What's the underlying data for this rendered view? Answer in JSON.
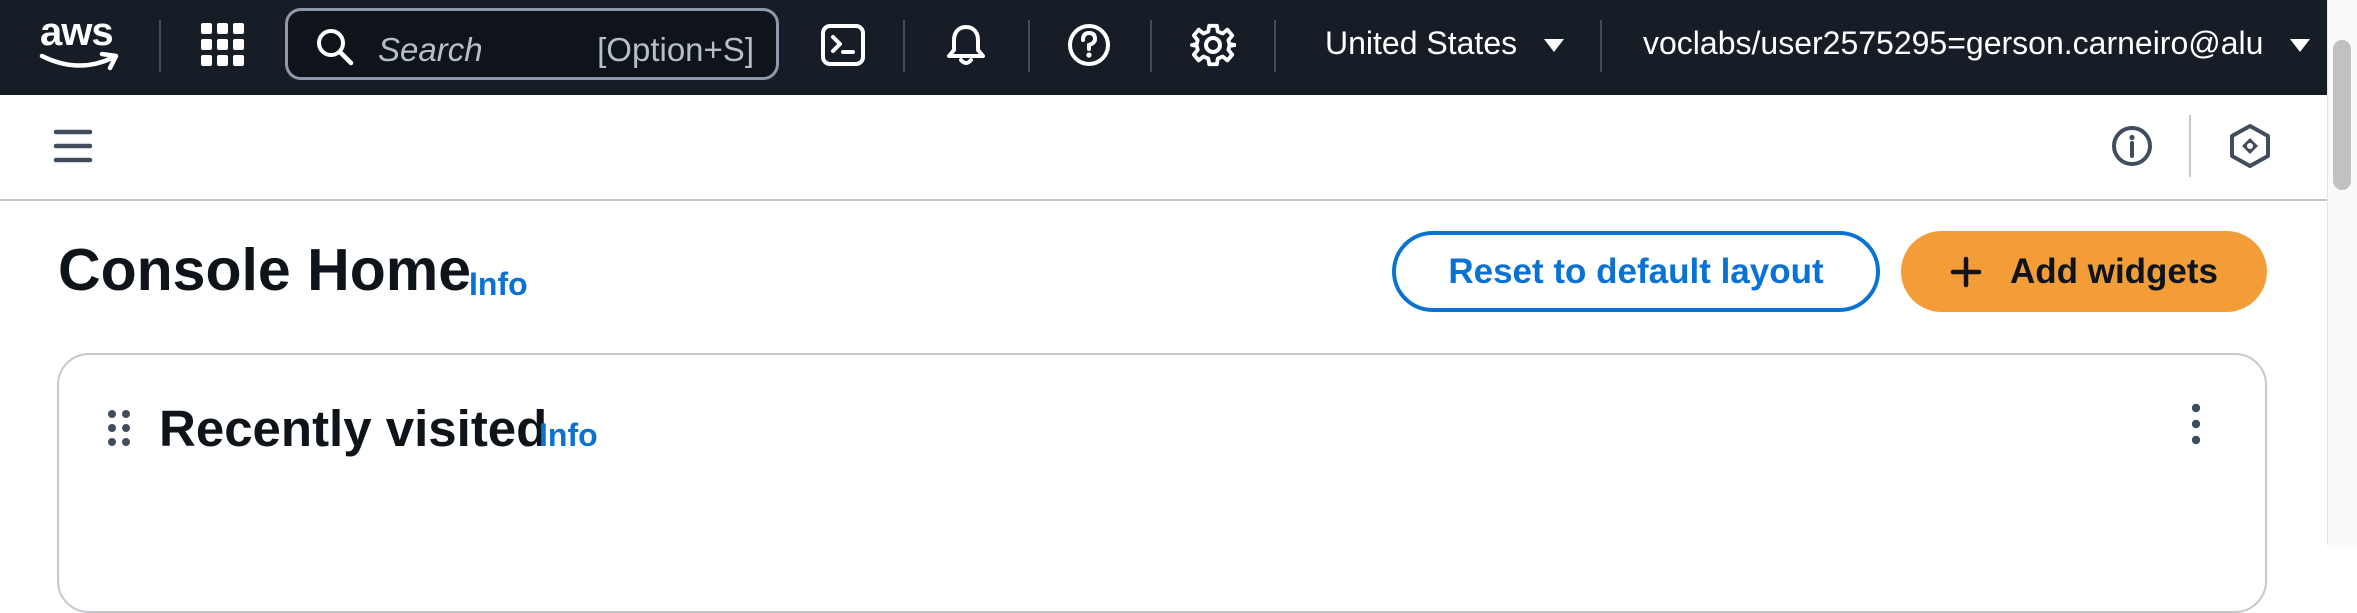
{
  "topnav": {
    "logo_text": "aws",
    "search": {
      "placeholder": "Search",
      "shortcut": "[Option+S]"
    },
    "region": "United States",
    "account": "voclabs/user2575295=gerson.carneiro@alu",
    "icons": [
      "services-grid-icon",
      "cloudshell-icon",
      "notifications-bell-icon",
      "help-icon",
      "settings-gear-icon"
    ],
    "colors": {
      "background": "#161d26",
      "text": "#ffffff"
    }
  },
  "subbar": {
    "icons": [
      "menu-icon",
      "info-circle-icon",
      "hexagon-icon"
    ]
  },
  "page": {
    "title": "Console Home",
    "info_label": "Info",
    "reset_button": "Reset to default layout",
    "add_button": "Add widgets",
    "colors": {
      "primary": "#f29d38",
      "link": "#0972d3"
    }
  },
  "widgets": [
    {
      "title": "Recently visited",
      "info_label": "Info"
    }
  ]
}
